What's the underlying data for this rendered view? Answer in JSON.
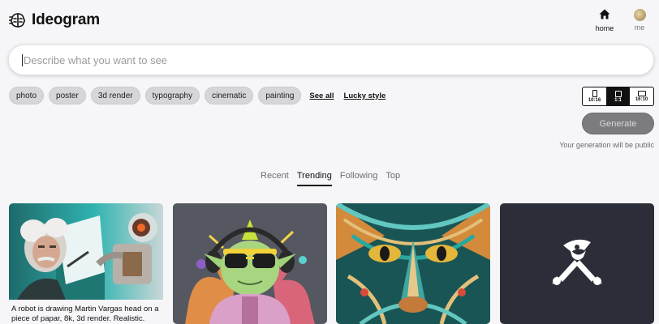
{
  "app": {
    "name": "Ideogram"
  },
  "nav": {
    "home_label": "home",
    "me_label": "me"
  },
  "prompt": {
    "placeholder": "Describe what you want to see",
    "value": ""
  },
  "styles": {
    "chips": [
      "photo",
      "poster",
      "3d render",
      "typography",
      "cinematic",
      "painting"
    ],
    "see_all": "See all",
    "lucky": "Lucky style"
  },
  "aspect": {
    "options": [
      "10:16",
      "1:1",
      "16:10"
    ],
    "selected": "1:1"
  },
  "generate": {
    "label": "Generate",
    "note": "Your generation will be public"
  },
  "tabs": [
    "Recent",
    "Trending",
    "Following",
    "Top"
  ],
  "active_tab": "Trending",
  "cards": [
    {
      "caption": "A robot is drawing Martin Vargas head on a piece of papar, 8k, 3d render. Realistic."
    }
  ],
  "colors": {
    "background": "#f6f6f8",
    "generate_disabled": "#7c7c7f",
    "chip": "#d6d6d8"
  }
}
